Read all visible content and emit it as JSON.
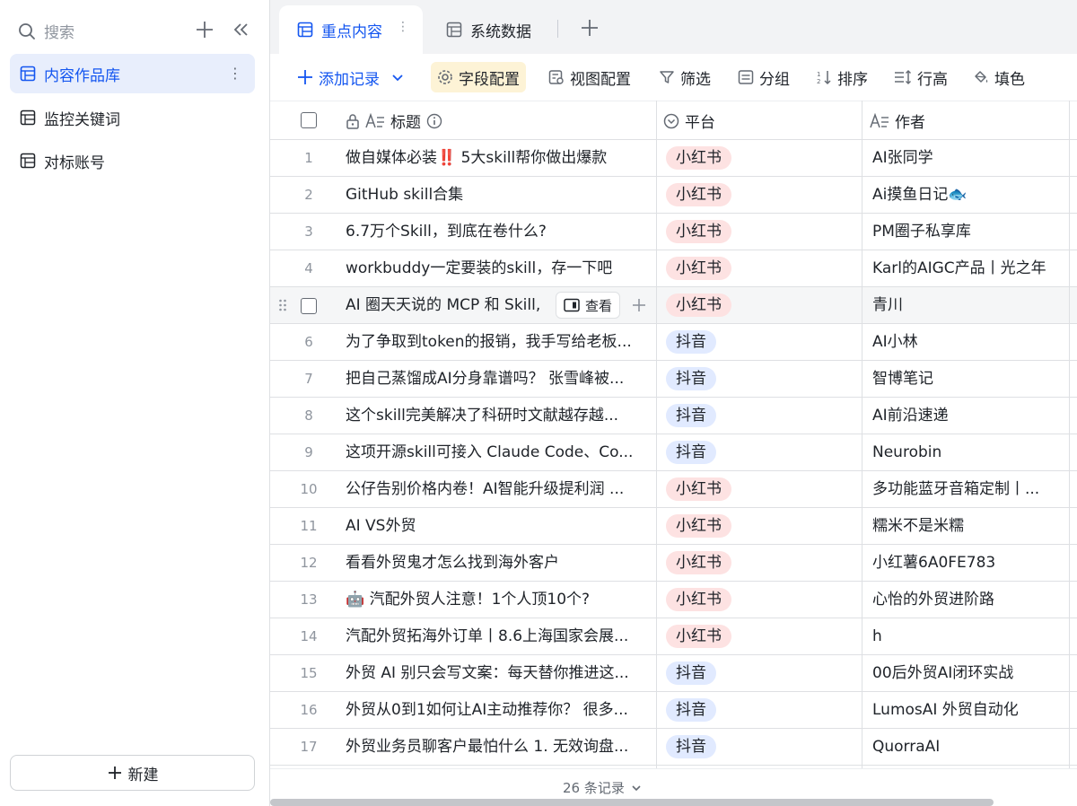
{
  "sidebar": {
    "search_placeholder": "搜索",
    "items": [
      {
        "label": "内容作品库",
        "active": true
      },
      {
        "label": "监控关键词",
        "active": false
      },
      {
        "label": "对标账号",
        "active": false
      }
    ],
    "new_label": "新建"
  },
  "tabs": [
    {
      "label": "重点内容",
      "active": true
    },
    {
      "label": "系统数据",
      "active": false
    }
  ],
  "toolbar": {
    "add_record": "添加记录",
    "field_config": "字段配置",
    "view_config": "视图配置",
    "filter": "筛选",
    "group": "分组",
    "sort": "排序",
    "row_height": "行高",
    "fill": "填色"
  },
  "columns": {
    "title": "标题",
    "platform": "平台",
    "author": "作者"
  },
  "row_actions": {
    "view": "查看"
  },
  "platform_colors": {
    "小红书": "#fde2e2",
    "抖音": "#e1eaff"
  },
  "rows": [
    {
      "num": "1",
      "title": "做自媒体必装‼️ 5大skill帮你做出爆款",
      "platform": "小红书",
      "author": "AI张同学"
    },
    {
      "num": "2",
      "title": "GitHub skill合集",
      "platform": "小红书",
      "author": "Ai摸鱼日记🐟"
    },
    {
      "num": "3",
      "title": "6.7万个Skill，到底在卷什么?",
      "platform": "小红书",
      "author": "PM圈子私享库"
    },
    {
      "num": "4",
      "title": "workbuddy一定要装的skill，存一下吧",
      "platform": "小红书",
      "author": "Karl的AIGC产品丨光之年"
    },
    {
      "num": "",
      "title": "AI 圈天天说的 MCP 和 Skill,",
      "platform": "小红书",
      "author": "青川",
      "hover": true
    },
    {
      "num": "6",
      "title": "为了争取到token的报销，我手写给老板...",
      "platform": "抖音",
      "author": "AI小林"
    },
    {
      "num": "7",
      "title": "把自己蒸馏成AI分身靠谱吗？ 张雪峰被...",
      "platform": "抖音",
      "author": "智博笔记"
    },
    {
      "num": "8",
      "title": "这个skill完美解决了科研时文献越存越...",
      "platform": "抖音",
      "author": "AI前沿速递"
    },
    {
      "num": "9",
      "title": "这项开源skill可接入 Claude Code、Co...",
      "platform": "抖音",
      "author": "Neurobin"
    },
    {
      "num": "10",
      "title": "公仔告别价格内卷！AI智能升级提利润 ...",
      "platform": "小红书",
      "author": "多功能蓝牙音箱定制丨..."
    },
    {
      "num": "11",
      "title": "AI VS外贸",
      "platform": "小红书",
      "author": "糯米不是米糯"
    },
    {
      "num": "12",
      "title": "看看外贸鬼才怎么找到海外客户",
      "platform": "小红书",
      "author": "小红薯6A0FE783"
    },
    {
      "num": "13",
      "title": "🤖 汽配外贸人注意！1个人顶10个?",
      "platform": "小红书",
      "author": "心怡的外贸进阶路"
    },
    {
      "num": "14",
      "title": "汽配外贸拓海外订单丨8.6上海国家会展...",
      "platform": "小红书",
      "author": "h"
    },
    {
      "num": "15",
      "title": "外贸 AI 别只会写文案：每天替你推进这...",
      "platform": "抖音",
      "author": "00后外贸AI闭环实战"
    },
    {
      "num": "16",
      "title": "外贸从0到1如何让AI主动推荐你？ 很多...",
      "platform": "抖音",
      "author": "LumosAI 外贸自动化"
    },
    {
      "num": "17",
      "title": "外贸业务员聊客户最怕什么 1. 无效询盘...",
      "platform": "抖音",
      "author": "QuorraAI"
    }
  ],
  "footer": {
    "count": "26 条记录"
  }
}
